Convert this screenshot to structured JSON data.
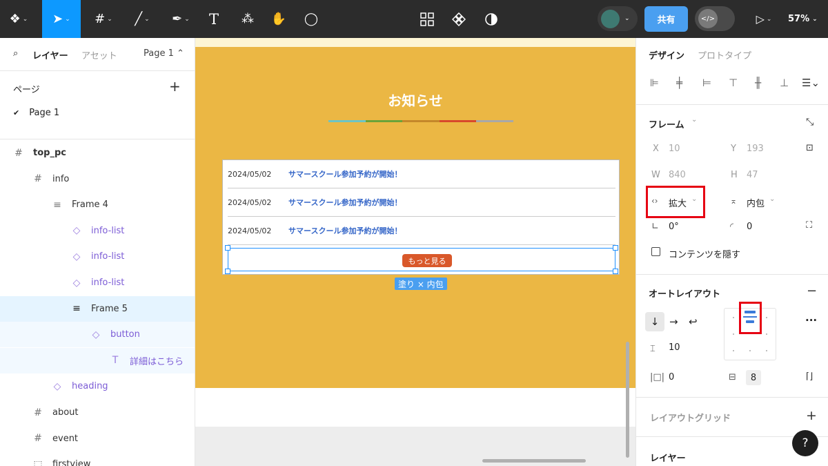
{
  "toolbar": {
    "tools": [
      {
        "name": "figma-menu",
        "icon": "❖",
        "chev": "⌄"
      },
      {
        "name": "move-tool",
        "icon": "➤",
        "chev": "⌄"
      },
      {
        "name": "frame-tool",
        "icon": "#",
        "chev": "⌄"
      },
      {
        "name": "line-tool",
        "icon": "╱",
        "chev": "⌄"
      },
      {
        "name": "pen-tool",
        "icon": "✒",
        "chev": "⌄"
      },
      {
        "name": "text-tool",
        "icon": "T"
      },
      {
        "name": "resources-tool",
        "icon": "⁂"
      },
      {
        "name": "hand-tool",
        "icon": "✋"
      },
      {
        "name": "comment-tool",
        "icon": "◯"
      }
    ],
    "share_label": "共有",
    "zoom": "57%",
    "accent": "#0d99ff"
  },
  "left": {
    "tabs": {
      "layers": "レイヤー",
      "assets": "アセット",
      "page": "Page 1 ⌃"
    },
    "pages_heading": "ページ",
    "current_page": "Page 1",
    "layers": [
      {
        "label": "top_pc",
        "icon": "#",
        "indent": 0,
        "bold": true
      },
      {
        "label": "info",
        "icon": "#",
        "indent": 1
      },
      {
        "label": "Frame 4",
        "icon": "≡",
        "indent": 2
      },
      {
        "label": "info-list",
        "icon": "◇",
        "indent": 3,
        "component": true
      },
      {
        "label": "info-list",
        "icon": "◇",
        "indent": 3,
        "component": true
      },
      {
        "label": "info-list",
        "icon": "◇",
        "indent": 3,
        "component": true
      },
      {
        "label": "Frame 5",
        "icon": "≡",
        "indent": 3,
        "selected": true
      },
      {
        "label": "button",
        "icon": "◇",
        "indent": 4,
        "component": true,
        "sub": true
      },
      {
        "label": "詳細はこちら",
        "icon": "T",
        "indent": 5,
        "component": true,
        "sub": true
      },
      {
        "label": "heading",
        "icon": "◇",
        "indent": 2,
        "component": true
      },
      {
        "label": "about",
        "icon": "#",
        "indent": 1
      },
      {
        "label": "event",
        "icon": "#",
        "indent": 1
      },
      {
        "label": "firstview",
        "icon": "⬚",
        "indent": 1
      }
    ]
  },
  "canvas": {
    "section_title": "お知らせ",
    "rainbow_colors": [
      "#6cc4c4",
      "#6aa33a",
      "#c4872a",
      "#d8482c",
      "#a8a8a8"
    ],
    "news": [
      {
        "date": "2024/05/02",
        "title": "サマースクール参加予約が開始！"
      },
      {
        "date": "2024/05/02",
        "title": "サマースクール参加予約が開始！"
      },
      {
        "date": "2024/05/02",
        "title": "サマースクール参加予約が開始！"
      }
    ],
    "more_button": "もっと見る",
    "size_badge": "塗り × 内包"
  },
  "right": {
    "tabs": {
      "design": "デザイン",
      "prototype": "プロトタイプ"
    },
    "frame_heading": "フレーム",
    "x_label": "X",
    "x_value": "10",
    "y_label": "Y",
    "y_value": "193",
    "w_label": "W",
    "w_value": "840",
    "h_label": "H",
    "h_value": "47",
    "width_mode": "拡大",
    "height_mode": "内包",
    "rotation": "0°",
    "radius": "0",
    "clip_content": "コンテンツを隠す",
    "autolayout_heading": "オートレイアウト",
    "gap": "10",
    "padding_h": "0",
    "padding_v": "8",
    "layout_grid_heading": "レイアウトグリッド",
    "layer_heading": "レイヤー",
    "help": "?",
    "highlight": "#e60012"
  }
}
